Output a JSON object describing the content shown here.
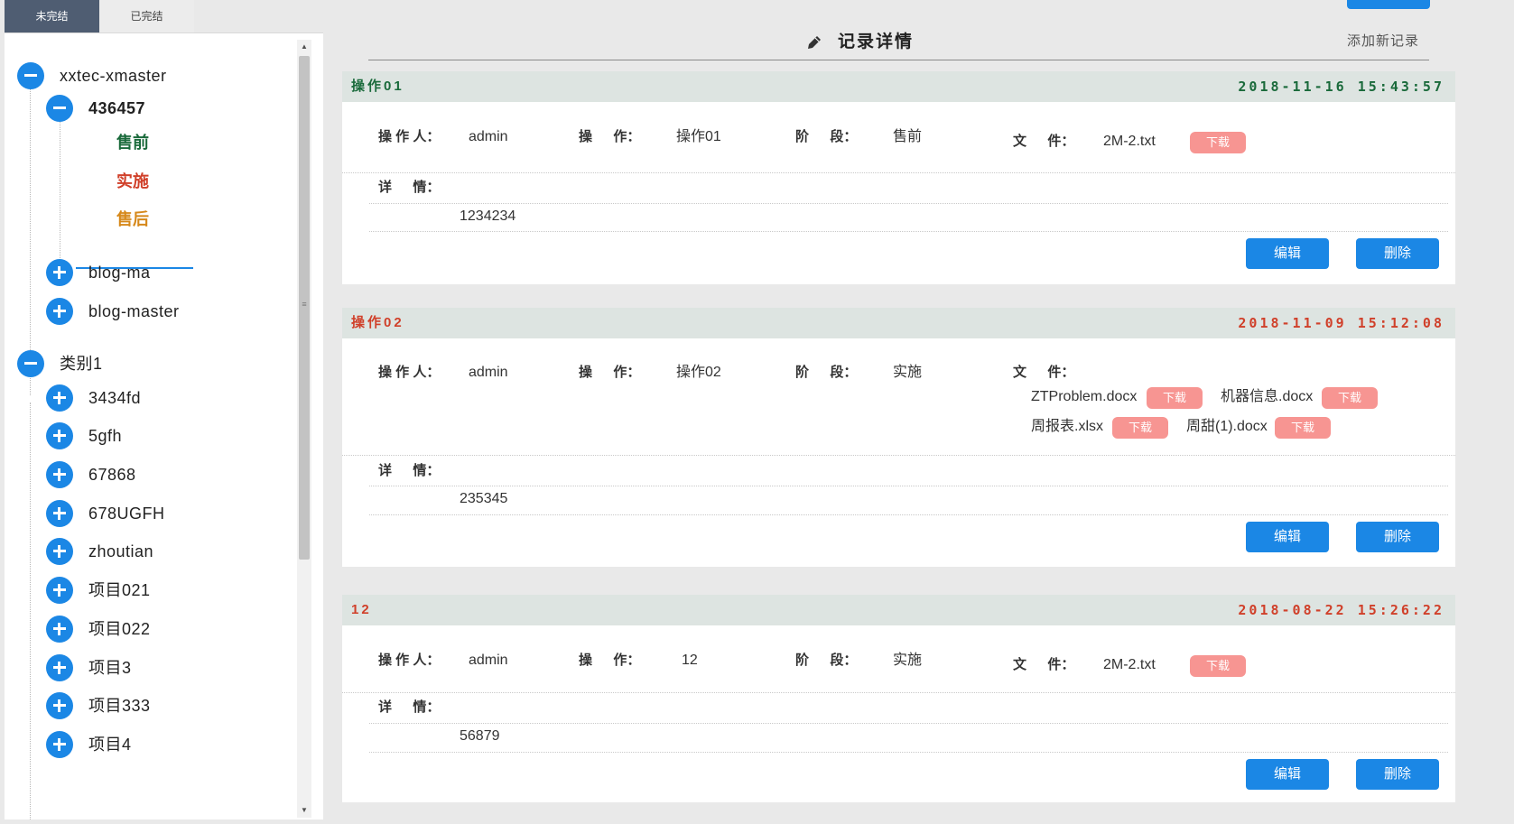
{
  "tabs": [
    {
      "label": "未完结",
      "active": true
    },
    {
      "label": "已完结",
      "active": false
    }
  ],
  "tree": {
    "groups": [
      {
        "label": "xxtec-xmaster",
        "expanded": true,
        "children": [
          {
            "label": "436457",
            "expanded": true,
            "stages": [
              {
                "label": "售前",
                "color": "#1a6a3b"
              },
              {
                "label": "实施",
                "color": "#d0402a"
              },
              {
                "label": "售后",
                "color": "#d6881a"
              }
            ]
          },
          {
            "label": "blog-ma",
            "expanded": false
          },
          {
            "label": "blog-master",
            "expanded": false
          }
        ]
      },
      {
        "label": "类别1",
        "expanded": true,
        "children": [
          {
            "label": "3434fd"
          },
          {
            "label": "5gfh"
          },
          {
            "label": "67868"
          },
          {
            "label": "678UGFH"
          },
          {
            "label": "zhoutian"
          },
          {
            "label": "项目021"
          },
          {
            "label": "项目022"
          },
          {
            "label": "项目3"
          },
          {
            "label": "项目333"
          },
          {
            "label": "项目4"
          }
        ]
      }
    ]
  },
  "header": {
    "title": "记录详情",
    "add_link": "添加新记录",
    "icon": "pencil-icon"
  },
  "labels": {
    "operator": "操 作 人：",
    "operation": "操 　 作：",
    "stage": "阶 　 段：",
    "file": "文 　 件：",
    "detail": "详 　 情：",
    "download": "下载",
    "edit": "编辑",
    "delete": "删除"
  },
  "records": [
    {
      "name": "操作01",
      "time": "2018-11-16 15:43:57",
      "name_color": "#1a6a3b",
      "operator": "admin",
      "operation": "操作01",
      "stage": "售前",
      "files": [
        "2M-2.txt"
      ],
      "detail": "1234234"
    },
    {
      "name": "操作02",
      "time": "2018-11-09 15:12:08",
      "name_color": "#d0402a",
      "operator": "admin",
      "operation": "操作02",
      "stage": "实施",
      "files": [
        "ZTProblem.docx",
        "机器信息.docx",
        "周报表.xlsx",
        "周甜(1).docx"
      ],
      "detail": "235345"
    },
    {
      "name": "12",
      "time": "2018-08-22 15:26:22",
      "name_color": "#d0402a",
      "operator": "admin",
      "operation": "12",
      "stage": "实施",
      "files": [
        "2M-2.txt"
      ],
      "detail": "56879"
    }
  ]
}
